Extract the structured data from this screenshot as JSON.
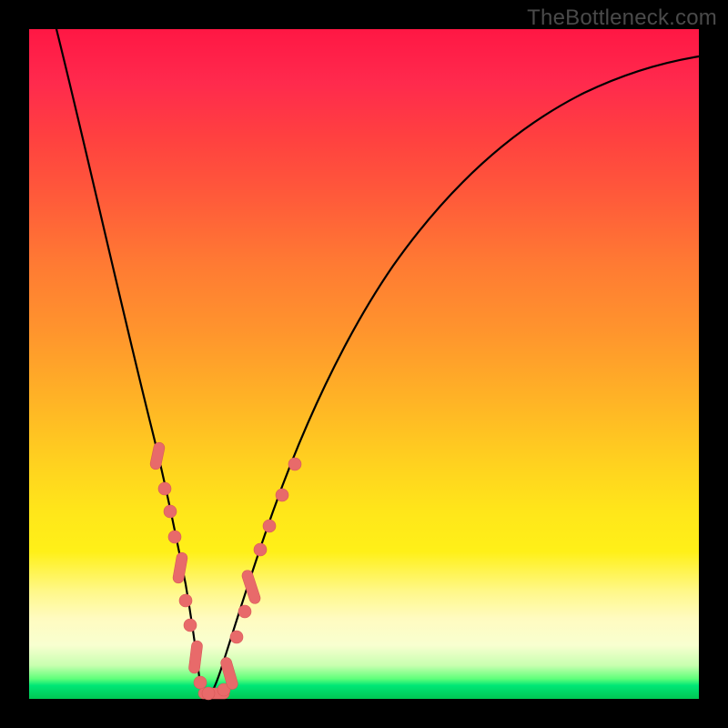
{
  "watermark": "TheBottleneck.com",
  "chart_data": {
    "type": "line",
    "title": "",
    "xlabel": "",
    "ylabel": "",
    "xlim": [
      0,
      100
    ],
    "ylim": [
      0,
      100
    ],
    "background_gradient": {
      "stops": [
        {
          "pos": 0,
          "color": "#ff1744"
        },
        {
          "pos": 25,
          "color": "#ff5a3a"
        },
        {
          "pos": 55,
          "color": "#ffd21f"
        },
        {
          "pos": 88,
          "color": "#fffbc0"
        },
        {
          "pos": 97,
          "color": "#5fff7a"
        },
        {
          "pos": 100,
          "color": "#00c853"
        }
      ]
    },
    "series": [
      {
        "name": "bottleneck-curve",
        "x": [
          0,
          4,
          8,
          12,
          14,
          16,
          18,
          20,
          21,
          22,
          23,
          24,
          25,
          26,
          27,
          28,
          29,
          31,
          34,
          38,
          44,
          52,
          62,
          74,
          88,
          100
        ],
        "y": [
          100,
          90,
          78,
          64,
          55,
          46,
          37,
          26,
          20,
          13,
          6,
          1,
          0,
          1,
          5,
          12,
          20,
          32,
          46,
          60,
          72,
          80,
          86,
          90,
          92,
          93
        ]
      }
    ],
    "markers": {
      "name": "highlighted-points",
      "color": "#e86a6a",
      "points": [
        {
          "x": 18.0,
          "y": 37
        },
        {
          "x": 18.5,
          "y": 33
        },
        {
          "x": 19.0,
          "y": 30
        },
        {
          "x": 20.0,
          "y": 24
        },
        {
          "x": 21.0,
          "y": 18
        },
        {
          "x": 21.8,
          "y": 13
        },
        {
          "x": 22.5,
          "y": 8
        },
        {
          "x": 23.2,
          "y": 4
        },
        {
          "x": 24.0,
          "y": 1
        },
        {
          "x": 24.5,
          "y": 0
        },
        {
          "x": 25.0,
          "y": 0
        },
        {
          "x": 25.8,
          "y": 1
        },
        {
          "x": 26.5,
          "y": 3
        },
        {
          "x": 27.5,
          "y": 8
        },
        {
          "x": 28.5,
          "y": 14
        },
        {
          "x": 29.2,
          "y": 19
        },
        {
          "x": 30.0,
          "y": 25
        },
        {
          "x": 30.8,
          "y": 30
        },
        {
          "x": 32.0,
          "y": 36
        },
        {
          "x": 33.0,
          "y": 41
        }
      ]
    }
  }
}
